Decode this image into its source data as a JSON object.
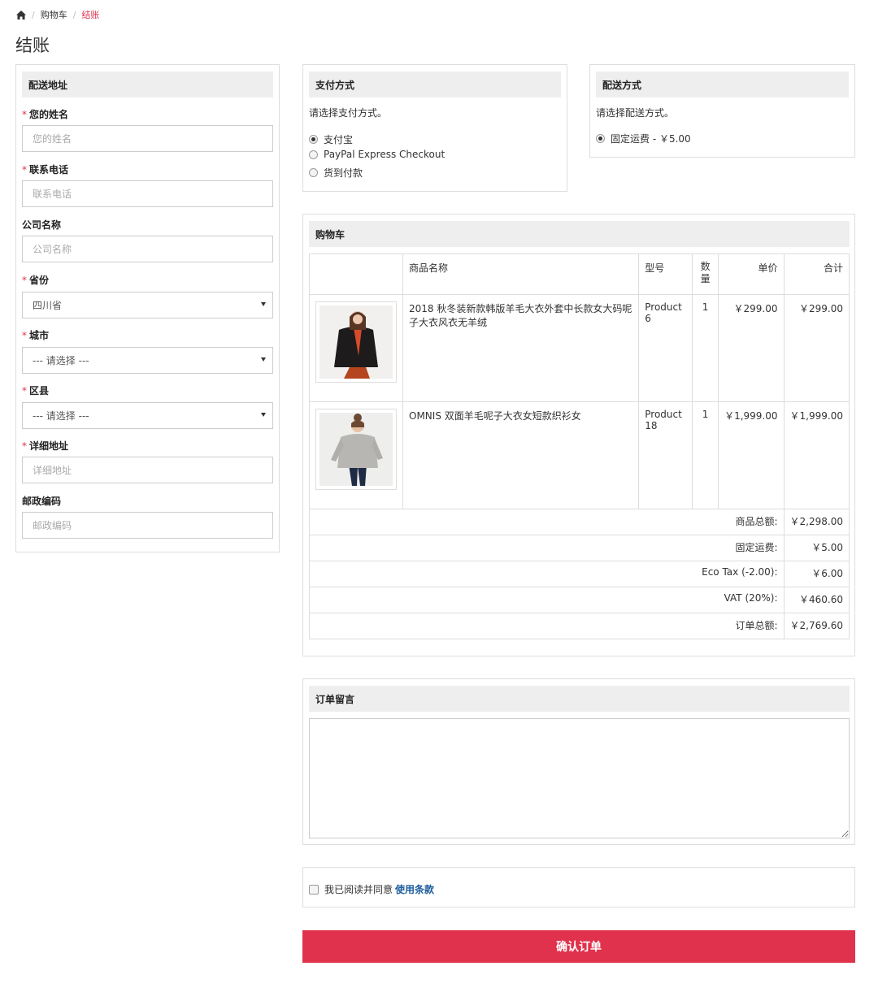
{
  "breadcrumb": {
    "home_icon": "home-icon",
    "items": [
      {
        "label": "购物车"
      },
      {
        "label": "结账"
      }
    ]
  },
  "page_title": "结账",
  "shipping_address": {
    "title": "配送地址",
    "required_mark": "*",
    "fields": {
      "name": {
        "label": "您的姓名",
        "placeholder": "您的姓名"
      },
      "phone": {
        "label": "联系电话",
        "placeholder": "联系电话"
      },
      "company": {
        "label": "公司名称",
        "placeholder": "公司名称"
      },
      "province": {
        "label": "省份",
        "value": "四川省"
      },
      "city": {
        "label": "城市",
        "value": "--- 请选择 ---"
      },
      "district": {
        "label": "区县",
        "value": "--- 请选择 ---"
      },
      "address": {
        "label": "详细地址",
        "placeholder": "详细地址"
      },
      "postcode": {
        "label": "邮政编码",
        "placeholder": "邮政编码"
      }
    }
  },
  "payment_method": {
    "title": "支付方式",
    "hint": "请选择支付方式。",
    "options": [
      {
        "label": "支付宝",
        "selected": true
      },
      {
        "label": "PayPal Express Checkout",
        "selected": false
      },
      {
        "label": "货到付款",
        "selected": false
      }
    ]
  },
  "shipping_method": {
    "title": "配送方式",
    "hint": "请选择配送方式。",
    "options": [
      {
        "label": "固定运费 - ￥5.00",
        "selected": true
      }
    ]
  },
  "cart": {
    "title": "购物车",
    "columns": {
      "image": "",
      "name": "商品名称",
      "model": "型号",
      "qty": "数量",
      "unit_price": "单价",
      "total": "合计"
    },
    "items": [
      {
        "name": "2018 秋冬装新款韩版羊毛大衣外套中长款女大码呢子大衣风衣无羊绒",
        "model": "Product 6",
        "qty": "1",
        "unit_price": "￥299.00",
        "total": "￥299.00"
      },
      {
        "name": "OMNIS 双面羊毛呢子大衣女短款织衫女",
        "model": "Product 18",
        "qty": "1",
        "unit_price": "￥1,999.00",
        "total": "￥1,999.00"
      }
    ],
    "totals": [
      {
        "label": "商品总额:",
        "value": "￥2,298.00"
      },
      {
        "label": "固定运费:",
        "value": "￥5.00"
      },
      {
        "label": "Eco Tax (-2.00):",
        "value": "￥6.00"
      },
      {
        "label": "VAT (20%):",
        "value": "￥460.60"
      },
      {
        "label": "订单总额:",
        "value": "￥2,769.60"
      }
    ]
  },
  "order_comment": {
    "title": "订单留言",
    "value": ""
  },
  "terms": {
    "text": "我已阅读并同意",
    "link": "使用条款"
  },
  "confirm_button": "确认订单",
  "colors": {
    "accent": "#e0324c",
    "link": "#1a5b9b",
    "panel_header": "#eeeeee",
    "border": "#dddddd"
  }
}
